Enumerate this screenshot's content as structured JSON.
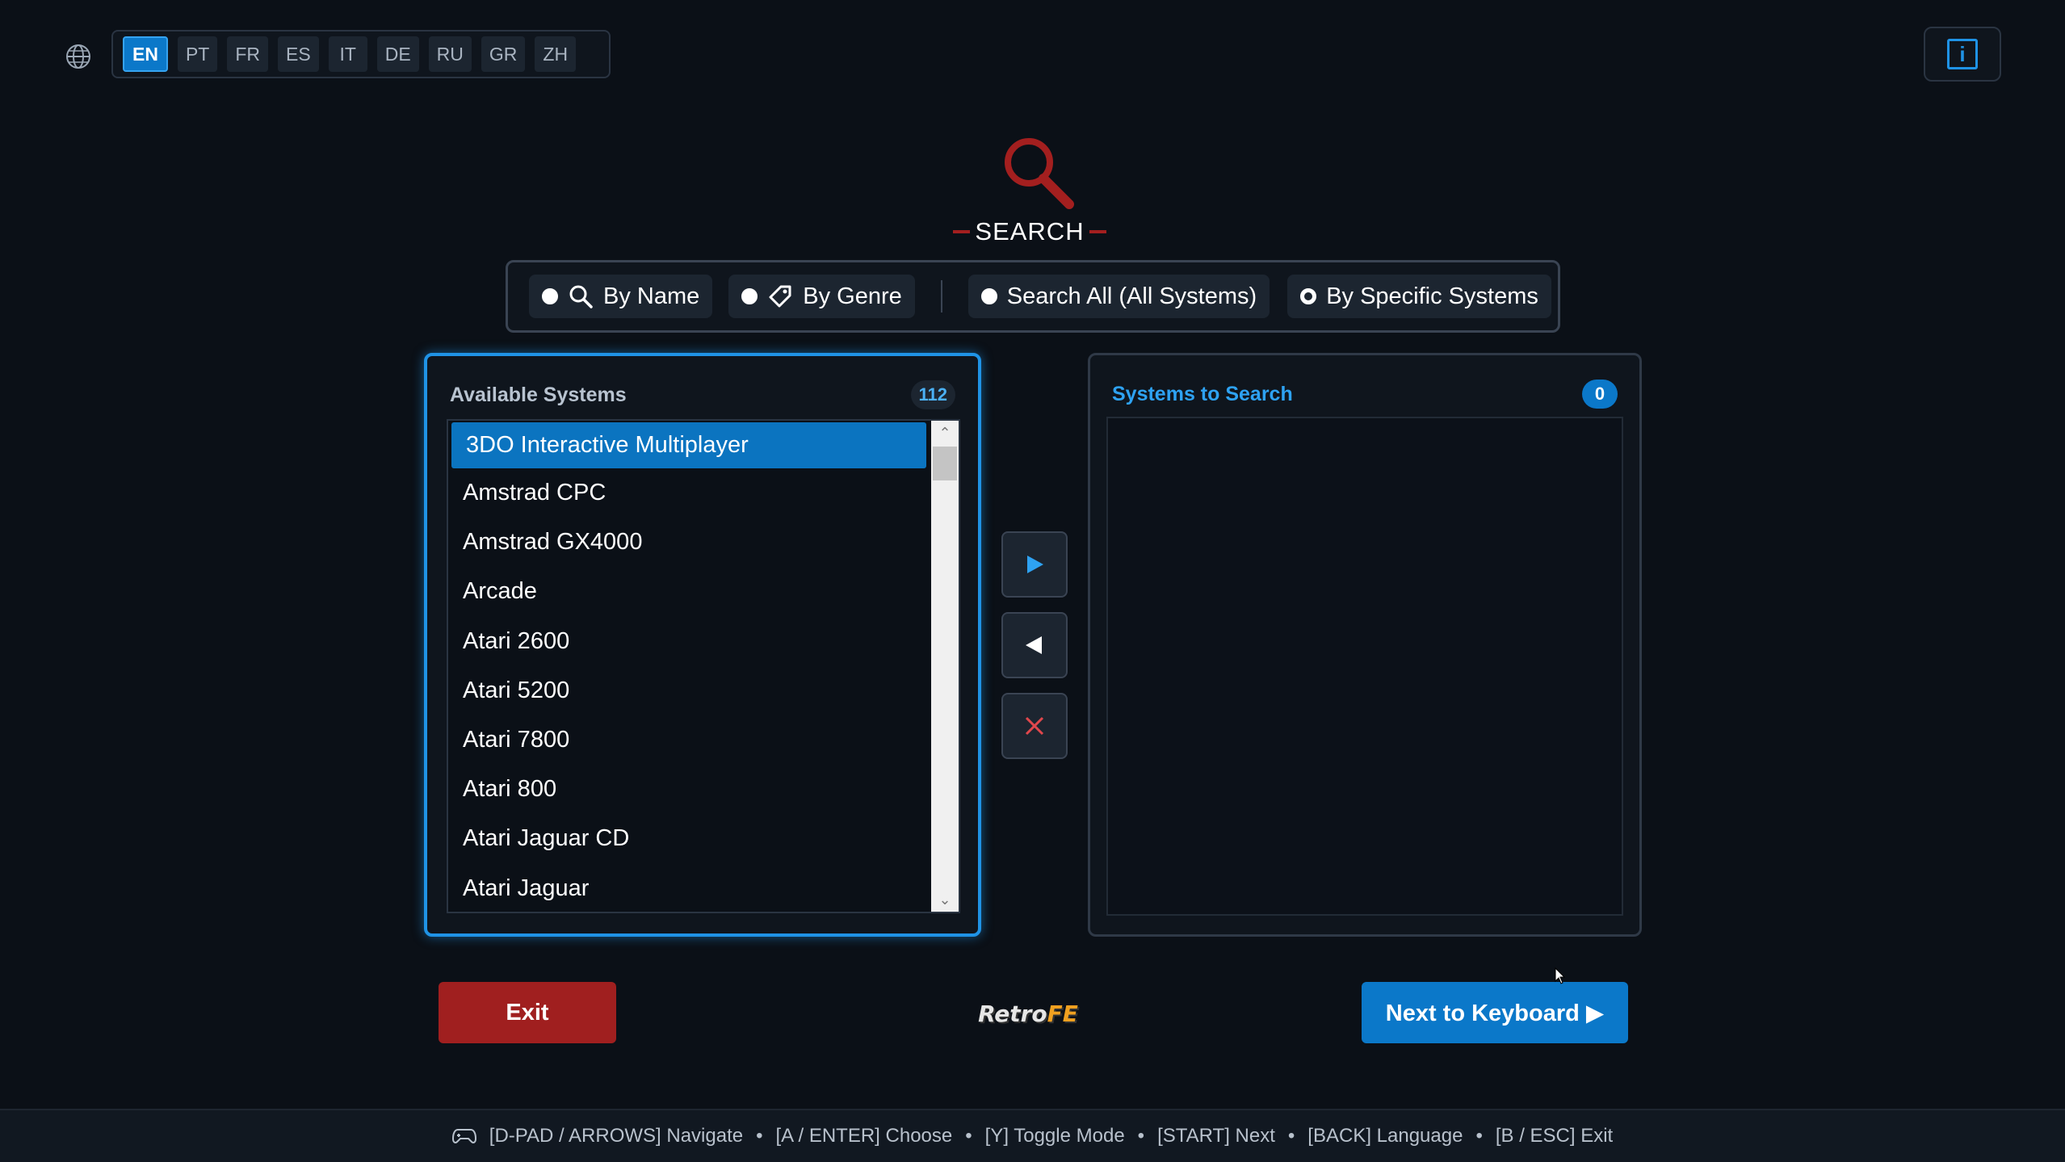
{
  "languages": [
    "EN",
    "PT",
    "FR",
    "ES",
    "IT",
    "DE",
    "RU",
    "GR",
    "ZH"
  ],
  "active_language": "EN",
  "info_button": "i",
  "header": {
    "title": "SEARCH"
  },
  "modes": {
    "by_name": "By Name",
    "by_genre": "By Genre",
    "search_all": "Search All (All Systems)",
    "by_specific": "By Specific Systems",
    "selected": "By Specific Systems"
  },
  "available": {
    "title": "Available Systems",
    "count": "112",
    "items": [
      "3DO Interactive Multiplayer",
      "Amstrad CPC",
      "Amstrad GX4000",
      "Arcade",
      "Atari 2600",
      "Atari 5200",
      "Atari 7800",
      "Atari 800",
      "Atari Jaguar CD",
      "Atari Jaguar"
    ],
    "selected_index": 0
  },
  "selected_systems": {
    "title": "Systems to Search",
    "count": "0",
    "items": []
  },
  "actions": {
    "exit": "Exit",
    "next": "Next to Keyboard ▶"
  },
  "brand": {
    "part1": "Retro",
    "part2": "FE"
  },
  "footer": {
    "hints": [
      "[D-PAD / ARROWS] Navigate",
      "[A / ENTER] Choose",
      "[Y] Toggle Mode",
      "[START] Next",
      "[BACK] Language",
      "[B / ESC] Exit"
    ]
  },
  "colors": {
    "accent": "#1f93e6",
    "exit": "#a01f1f",
    "background": "#0b1017",
    "search_logo": "#a31f1f"
  }
}
